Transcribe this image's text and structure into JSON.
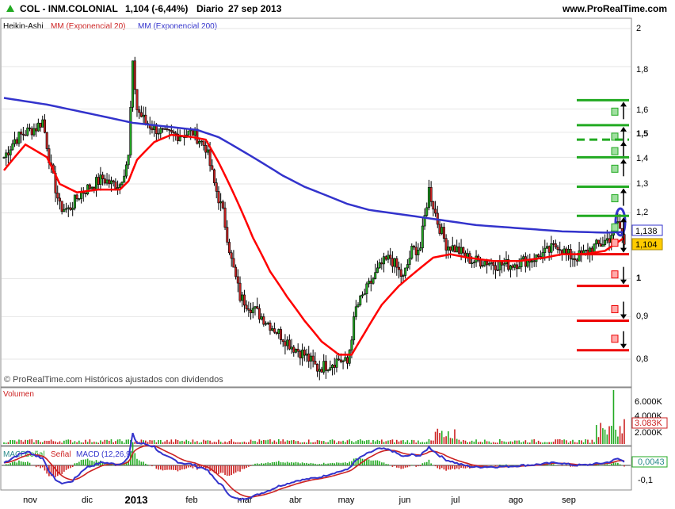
{
  "header": {
    "symbol": "COL - INM.COLONIAL",
    "price": "1,104 (-6,44%)",
    "period": "Diario",
    "date": "27 sep 2013",
    "site": "www.ProRealTime.com"
  },
  "legend": {
    "ha": "Heikin-Ashi",
    "mm20": "MM (Exponencial 20)",
    "mm200": "MM (Exponencial 200)"
  },
  "watermark": "© ProRealTime.com Históricos ajustados con dividendos",
  "volume_panel": {
    "title": "Volumen",
    "ticks": [
      "6.000K",
      "4.000K",
      "2.000K"
    ],
    "last": "3.083K"
  },
  "macd_panel": {
    "title_parts": [
      "MACD",
      "Señal",
      "Señal",
      "MACD",
      "(12,26,9)"
    ],
    "ticks": [
      "-0,1"
    ],
    "last": "0,0043"
  },
  "colors": {
    "mm20": "#ff0000",
    "mm200": "#3333cc",
    "bull": "#22aa22",
    "bear": "#cc2222",
    "candle": "#000000",
    "level_green": "#22aa22",
    "level_red": "#ee0000",
    "price_box": "#ffcc00",
    "grid": "#e6e6e6"
  },
  "chart_data": {
    "type": "candlestick",
    "price_axis": {
      "ticks": [
        "2",
        "1,8",
        "1,6",
        "1,5",
        "1,4",
        "1,3",
        "1,2",
        "1",
        "0,9",
        "0,8"
      ],
      "tick_values": [
        2,
        1.8,
        1.6,
        1.5,
        1.4,
        1.3,
        1.2,
        1,
        0.9,
        0.8
      ]
    },
    "x_axis": {
      "labels": [
        "nov",
        "dic",
        "2013",
        "feb",
        "mar",
        "abr",
        "may",
        "jun",
        "jul",
        "ago",
        "sep"
      ]
    },
    "last_price": "1,104",
    "mm200_value": "1,138",
    "close_anchors": [
      [
        0,
        1.4
      ],
      [
        5,
        1.47
      ],
      [
        10,
        1.5
      ],
      [
        15,
        1.52
      ],
      [
        18,
        1.55
      ],
      [
        22,
        1.35
      ],
      [
        26,
        1.22
      ],
      [
        30,
        1.21
      ],
      [
        36,
        1.27
      ],
      [
        40,
        1.29
      ],
      [
        46,
        1.32
      ],
      [
        50,
        1.3
      ],
      [
        54,
        1.3
      ],
      [
        58,
        1.4
      ],
      [
        60,
        1.8
      ],
      [
        62,
        1.6
      ],
      [
        66,
        1.54
      ],
      [
        70,
        1.52
      ],
      [
        75,
        1.49
      ],
      [
        82,
        1.49
      ],
      [
        88,
        1.5
      ],
      [
        94,
        1.44
      ],
      [
        98,
        1.3
      ],
      [
        102,
        1.2
      ],
      [
        106,
        1.05
      ],
      [
        110,
        0.95
      ],
      [
        116,
        0.92
      ],
      [
        122,
        0.89
      ],
      [
        128,
        0.86
      ],
      [
        134,
        0.83
      ],
      [
        140,
        0.81
      ],
      [
        146,
        0.78
      ],
      [
        152,
        0.79
      ],
      [
        156,
        0.8
      ],
      [
        160,
        0.79
      ],
      [
        164,
        0.92
      ],
      [
        170,
        0.98
      ],
      [
        176,
        1.04
      ],
      [
        180,
        1.06
      ],
      [
        186,
        1.0
      ],
      [
        190,
        1.08
      ],
      [
        194,
        1.09
      ],
      [
        198,
        1.28
      ],
      [
        202,
        1.17
      ],
      [
        206,
        1.1
      ],
      [
        212,
        1.08
      ],
      [
        218,
        1.05
      ],
      [
        224,
        1.05
      ],
      [
        230,
        1.04
      ],
      [
        236,
        1.04
      ],
      [
        242,
        1.05
      ],
      [
        248,
        1.06
      ],
      [
        254,
        1.08
      ],
      [
        258,
        1.1
      ],
      [
        262,
        1.07
      ],
      [
        266,
        1.06
      ],
      [
        270,
        1.07
      ],
      [
        274,
        1.09
      ],
      [
        278,
        1.1
      ],
      [
        282,
        1.12
      ],
      [
        286,
        1.17
      ],
      [
        289,
        1.104
      ]
    ],
    "mm20": [
      [
        0,
        1.35
      ],
      [
        10,
        1.45
      ],
      [
        20,
        1.4
      ],
      [
        26,
        1.3
      ],
      [
        34,
        1.27
      ],
      [
        44,
        1.28
      ],
      [
        54,
        1.28
      ],
      [
        58,
        1.31
      ],
      [
        62,
        1.39
      ],
      [
        70,
        1.46
      ],
      [
        78,
        1.49
      ],
      [
        88,
        1.48
      ],
      [
        94,
        1.47
      ],
      [
        100,
        1.38
      ],
      [
        108,
        1.25
      ],
      [
        116,
        1.12
      ],
      [
        124,
        1.02
      ],
      [
        132,
        0.95
      ],
      [
        140,
        0.89
      ],
      [
        148,
        0.84
      ],
      [
        156,
        0.81
      ],
      [
        162,
        0.81
      ],
      [
        168,
        0.86
      ],
      [
        176,
        0.93
      ],
      [
        184,
        0.98
      ],
      [
        192,
        1.02
      ],
      [
        200,
        1.06
      ],
      [
        208,
        1.07
      ],
      [
        216,
        1.06
      ],
      [
        228,
        1.05
      ],
      [
        240,
        1.05
      ],
      [
        252,
        1.06
      ],
      [
        260,
        1.07
      ],
      [
        270,
        1.07
      ],
      [
        280,
        1.08
      ],
      [
        289,
        1.12
      ]
    ],
    "mm200": [
      [
        0,
        1.65
      ],
      [
        20,
        1.62
      ],
      [
        40,
        1.58
      ],
      [
        60,
        1.54
      ],
      [
        80,
        1.52
      ],
      [
        90,
        1.51
      ],
      [
        100,
        1.48
      ],
      [
        110,
        1.43
      ],
      [
        120,
        1.38
      ],
      [
        130,
        1.33
      ],
      [
        140,
        1.29
      ],
      [
        150,
        1.26
      ],
      [
        160,
        1.23
      ],
      [
        170,
        1.21
      ],
      [
        180,
        1.2
      ],
      [
        190,
        1.19
      ],
      [
        200,
        1.18
      ],
      [
        210,
        1.17
      ],
      [
        220,
        1.16
      ],
      [
        230,
        1.155
      ],
      [
        240,
        1.15
      ],
      [
        250,
        1.145
      ],
      [
        260,
        1.14
      ],
      [
        270,
        1.138
      ],
      [
        280,
        1.136
      ],
      [
        289,
        1.138
      ]
    ],
    "target_levels_up": [
      1.64,
      1.53,
      1.47,
      1.4,
      1.29,
      1.19
    ],
    "target_levels_down": [
      1.07,
      0.98,
      0.89,
      0.82
    ],
    "volume": {
      "last": 3083,
      "peak": 6700
    },
    "macd": {
      "last": 0.0043
    }
  }
}
